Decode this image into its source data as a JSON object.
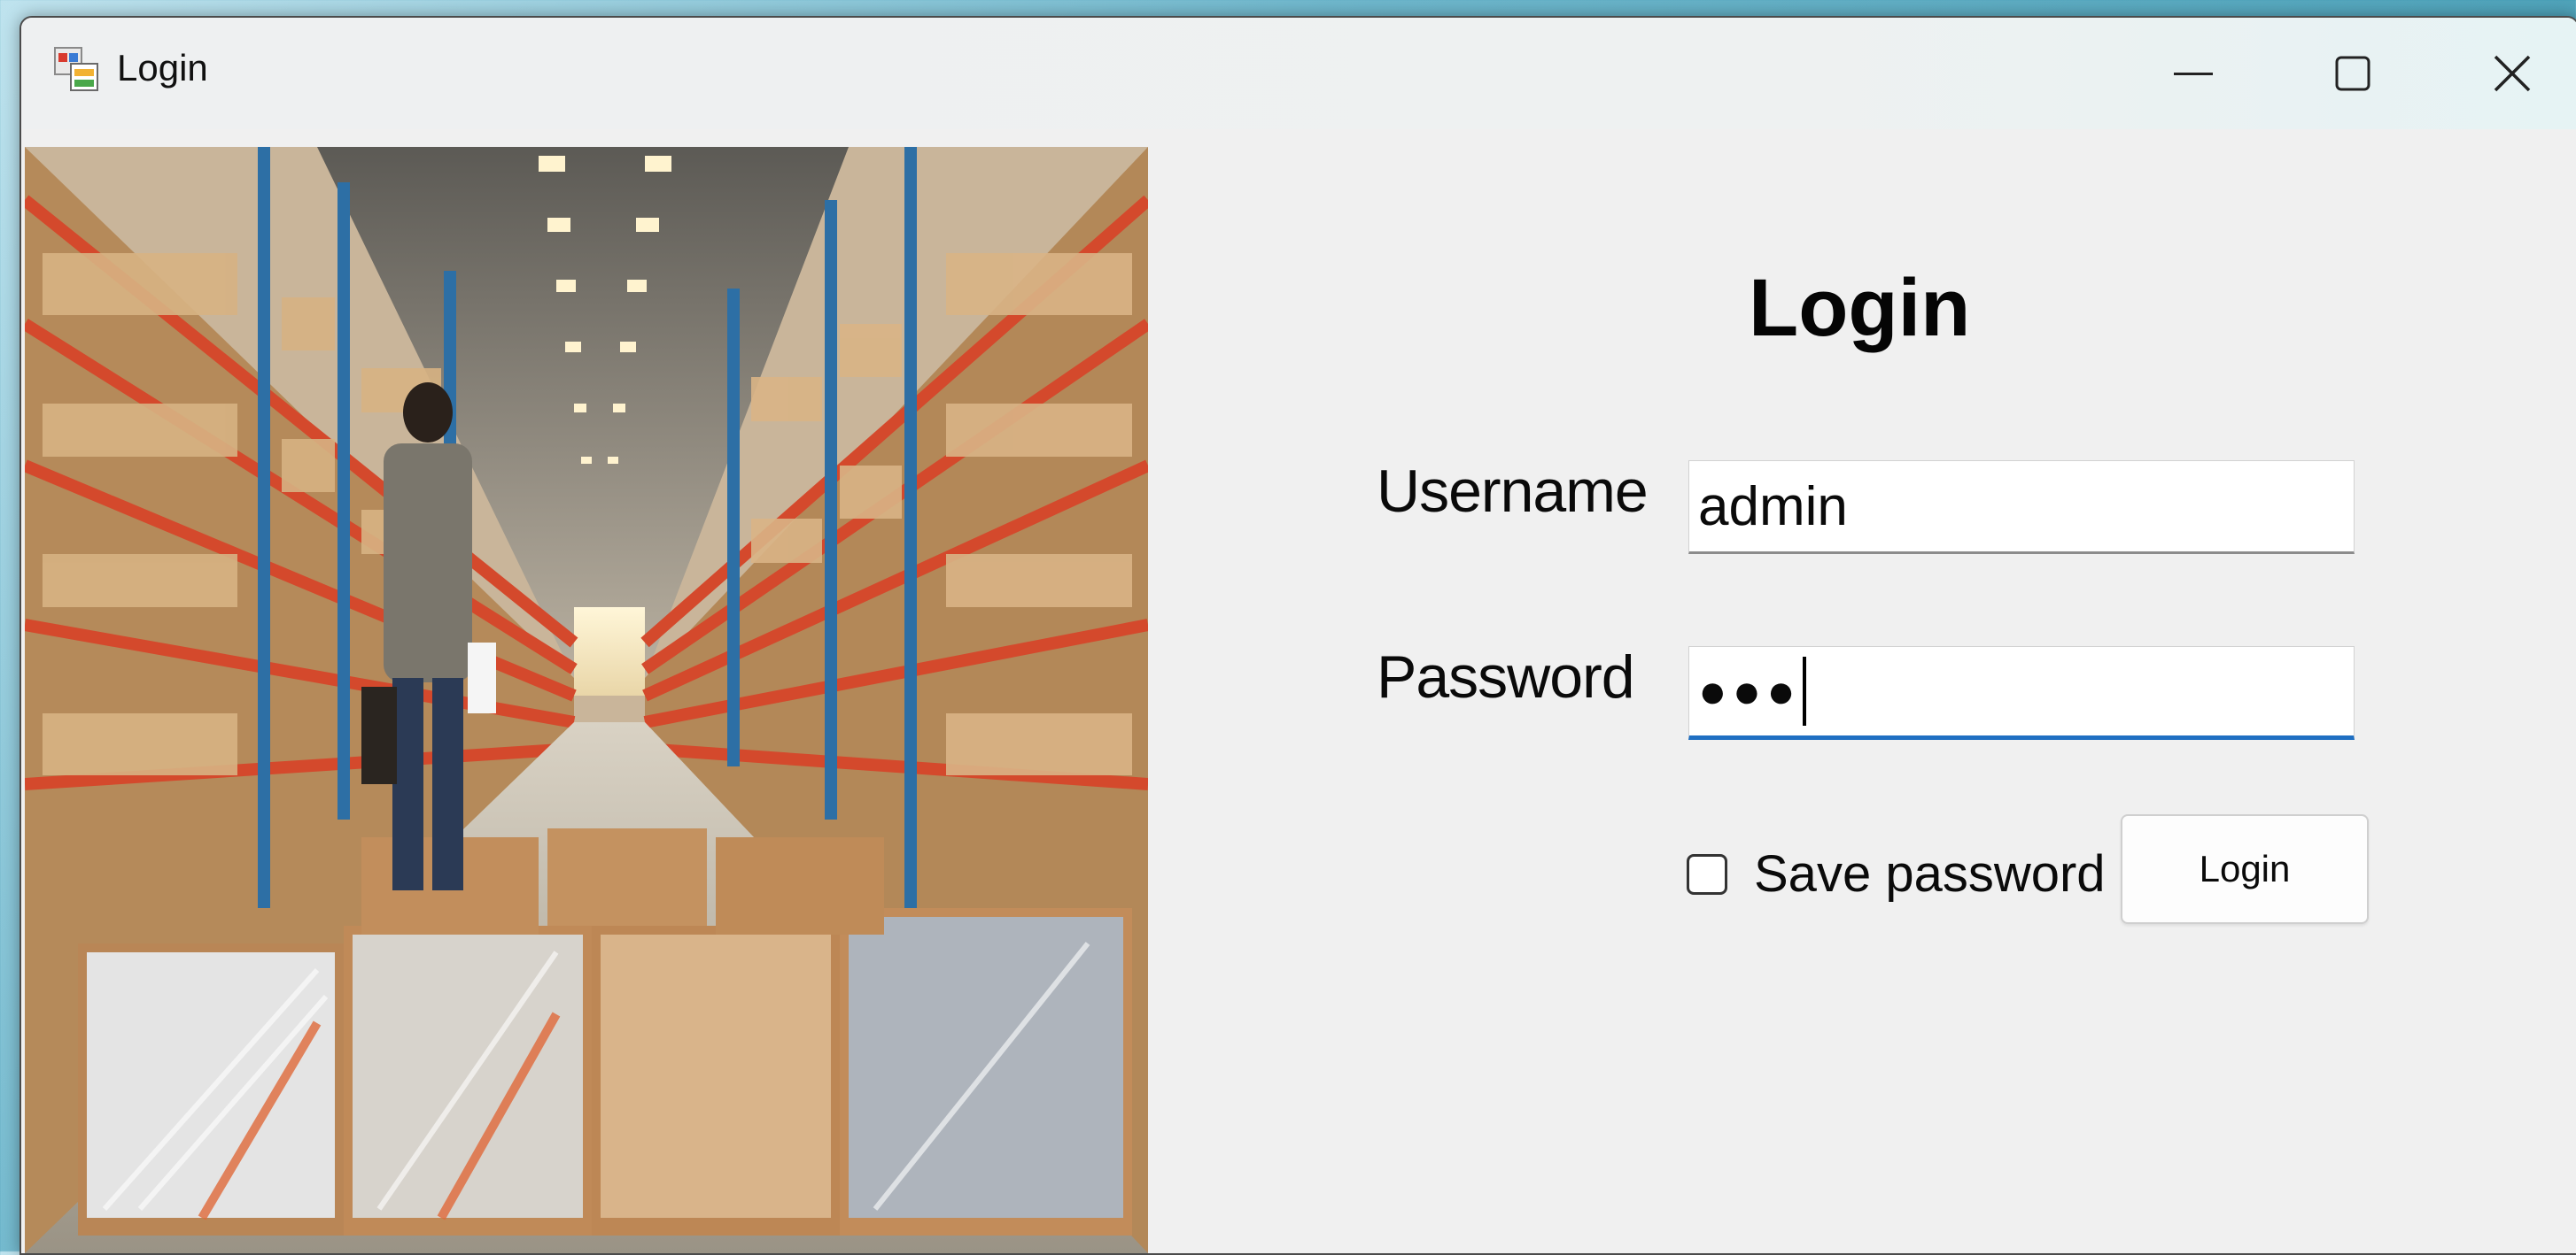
{
  "window": {
    "title": "Login",
    "app_icon": "winforms-app-icon",
    "controls": {
      "minimize_icon": "minimize-icon",
      "maximize_icon": "maximize-icon",
      "close_icon": "close-icon"
    }
  },
  "image": {
    "subject": "warehouse-aisle-illustration"
  },
  "form": {
    "title": "Login",
    "username": {
      "label": "Username",
      "value": "admin"
    },
    "password": {
      "label": "Password",
      "masked_value": "●●●"
    },
    "save_password": {
      "label": "Save password",
      "checked": false
    },
    "login_button": {
      "label": "Login"
    }
  },
  "colors": {
    "focus_underline": "#1f6fc2",
    "window_background": "#f0f0f0"
  }
}
